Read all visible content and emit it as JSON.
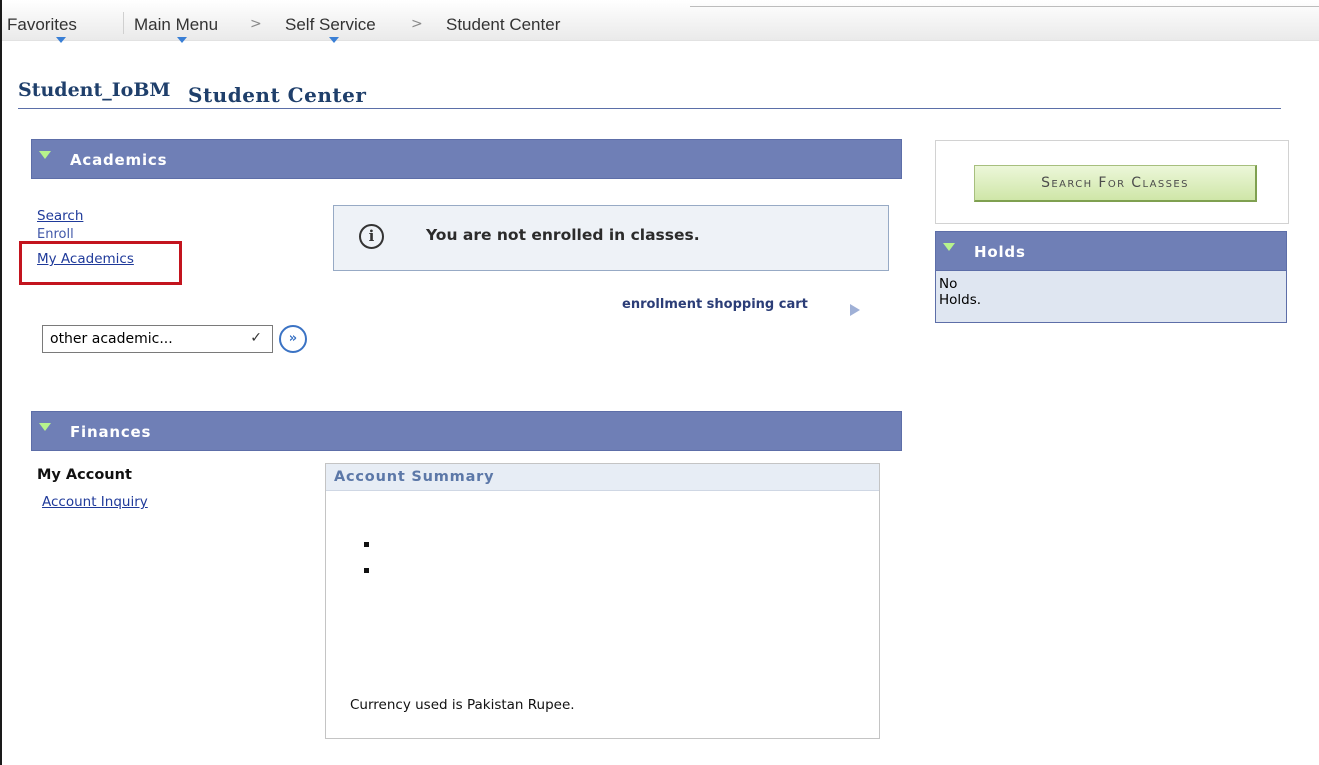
{
  "nav": {
    "favorites": "Favorites",
    "main_menu": "Main Menu",
    "self_service": "Self Service",
    "student_center": "Student Center",
    "separator": ">"
  },
  "header": {
    "user": "Student_IoBM",
    "title": "Student Center"
  },
  "academics": {
    "title": "Academics",
    "links": {
      "search": "Search",
      "enroll": "Enroll",
      "my_academics": "My Academics"
    },
    "info_message": "You are not enrolled in classes.",
    "shopping_cart_link": "enrollment shopping cart",
    "dropdown_value": "other academic..."
  },
  "finances": {
    "title": "Finances",
    "my_account_label": "My Account",
    "account_inquiry_link": "Account Inquiry",
    "summary_title": "Account Summary",
    "currency_note": "Currency used is Pakistan Rupee."
  },
  "sidebar": {
    "search_button": "Search For Classes",
    "holds_title": "Holds",
    "holds_line1": "No",
    "holds_line2": "Holds."
  },
  "colors": {
    "section_bar": "#6f7fb6",
    "link": "#1f3a9a",
    "highlight_box": "#c3141e",
    "search_button": "#cfe6a8"
  }
}
